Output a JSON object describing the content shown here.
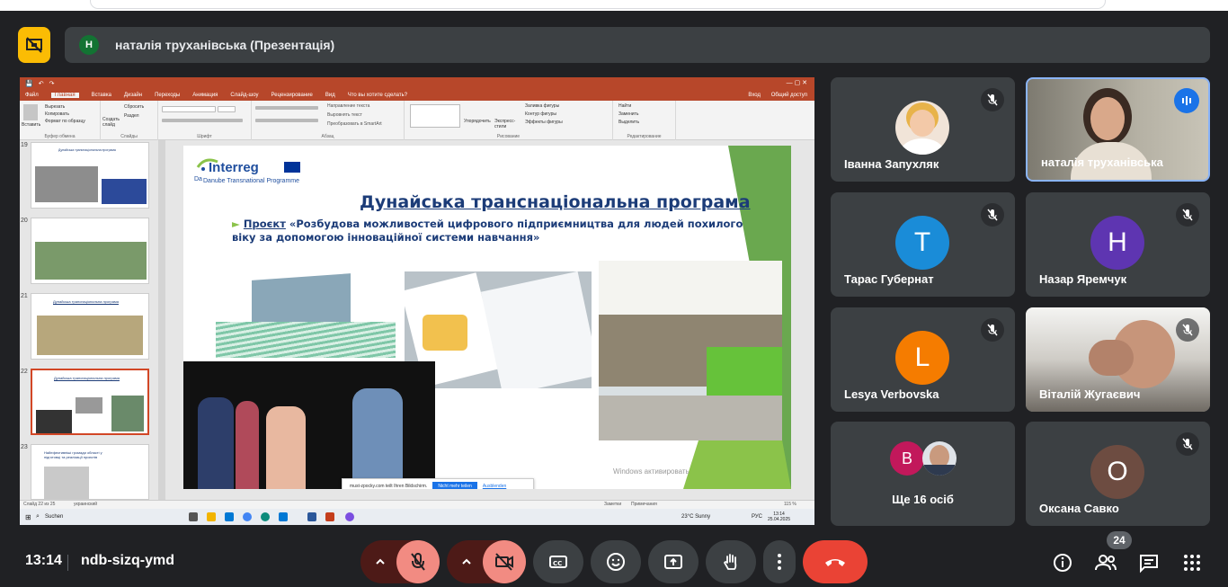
{
  "presenter_bar": {
    "avatar_letter": "Н",
    "title": "наталія труханівська (Презентація)"
  },
  "powerpoint": {
    "tabs": [
      "Файл",
      "Главная",
      "Вставка",
      "Дизайн",
      "Переходы",
      "Анимация",
      "Слайд-шоу",
      "Рецензирование",
      "Вид",
      "Что вы хотите сделать?"
    ],
    "active_tab": "Главная",
    "ribbon_groups": [
      "Буфер обмена",
      "Слайды",
      "Шрифт",
      "Абзац",
      "Рисование",
      "Редактирование"
    ],
    "ribbon_items": {
      "paste": "Вставить",
      "cut": "Вырезать",
      "copy": "Копировать",
      "format_painter": "Формат по образцу",
      "create_slide": "Создать слайд",
      "reset": "Сбросить",
      "section": "Раздел",
      "arrange": "Упорядочить",
      "styles": "Экспресс-стили",
      "find": "Найти",
      "replace": "Заменить",
      "select": "Выделить",
      "vertical_text": "Направление текста",
      "align_text": "Выровнять текст",
      "smartart": "Преобразовать в SmartArt",
      "fill": "Заливка фигуры",
      "outline": "Контур фигуры",
      "effects": "Эффекты фигуры",
      "login": "Вход",
      "share": "Общий доступ"
    },
    "slide_numbers": [
      "19",
      "20",
      "21",
      "22",
      "23"
    ],
    "selected_slide": "22",
    "slide": {
      "logo_word": "Interreg",
      "logo_sub": "Danube Transnational Programme",
      "logo_da": "Da",
      "title": "Дунайська транснаціональна програма",
      "bullet_label": "Проєкт",
      "bullet_text": "«Розбудова можливостей цифрового підприємництва для людей похилого віку за допомогою інноваційної системи навчання»"
    },
    "thumb_titles": {
      "t19": "Дунайська транснаціональна програма",
      "t21": "Дунайська транснаціональна програма",
      "t22": "Дунайська транснаціональна програма",
      "t23": "Найефективніші громади області у підготовці та реалізації проєктів"
    },
    "cookie": {
      "text": "must-zpocky.com teilt Ihren Bildschirm.",
      "button": "Nicht mehr teilen",
      "link": "Ausblenden"
    },
    "watermark": "Windows активировать",
    "status": {
      "slide_info": "Слайд 22 из 25",
      "language": "украинский",
      "notes": "Заметки",
      "comments": "Примечания",
      "zoom": "115 %"
    },
    "taskbar": {
      "search": "Suchen",
      "weather": "23°C  Sunny",
      "lang": "РУС",
      "time": "13:14",
      "date": "25.04.2025"
    }
  },
  "participants": [
    {
      "name": "Іванна Запухляк",
      "type": "photo",
      "muted": true
    },
    {
      "name": "наталія труханівська",
      "type": "video",
      "speaking": true
    },
    {
      "name": "Тарас Губернат",
      "type": "avatar",
      "letter": "Т",
      "color": "#1a8cd8",
      "muted": true
    },
    {
      "name": "Назар Яремчук",
      "type": "avatar",
      "letter": "Н",
      "color": "#5e35b1",
      "muted": true
    },
    {
      "name": "Lesya Verbovska",
      "type": "avatar",
      "letter": "L",
      "color": "#f57c00",
      "muted": true
    },
    {
      "name": "Віталій Жугаєвич",
      "type": "video",
      "muted": true
    },
    {
      "name": "Ще 16 осіб",
      "type": "group",
      "letter": "В"
    },
    {
      "name": "Оксана Савко",
      "type": "avatar",
      "letter": "О",
      "color": "#6d4c41",
      "muted": true
    }
  ],
  "bottom_bar": {
    "time": "13:14",
    "meeting_code": "ndb-sizq-ymd",
    "participant_count": "24"
  },
  "colors": {
    "meet_bg": "#202124",
    "tile_bg": "#3c4043",
    "mute_red": "#f28b82",
    "end_call": "#ea4335",
    "powerpoint_accent": "#b7472a",
    "interreg_blue": "#1f4e9e",
    "slide_green": "#8bc34a"
  },
  "icons": [
    "presenting-off-icon",
    "mic-off-icon",
    "camera-off-icon",
    "captions-icon",
    "emoji-icon",
    "present-screen-icon",
    "raise-hand-icon",
    "more-options-icon",
    "end-call-icon",
    "info-icon",
    "people-icon",
    "chat-icon",
    "activities-icon",
    "chevron-up-icon"
  ]
}
